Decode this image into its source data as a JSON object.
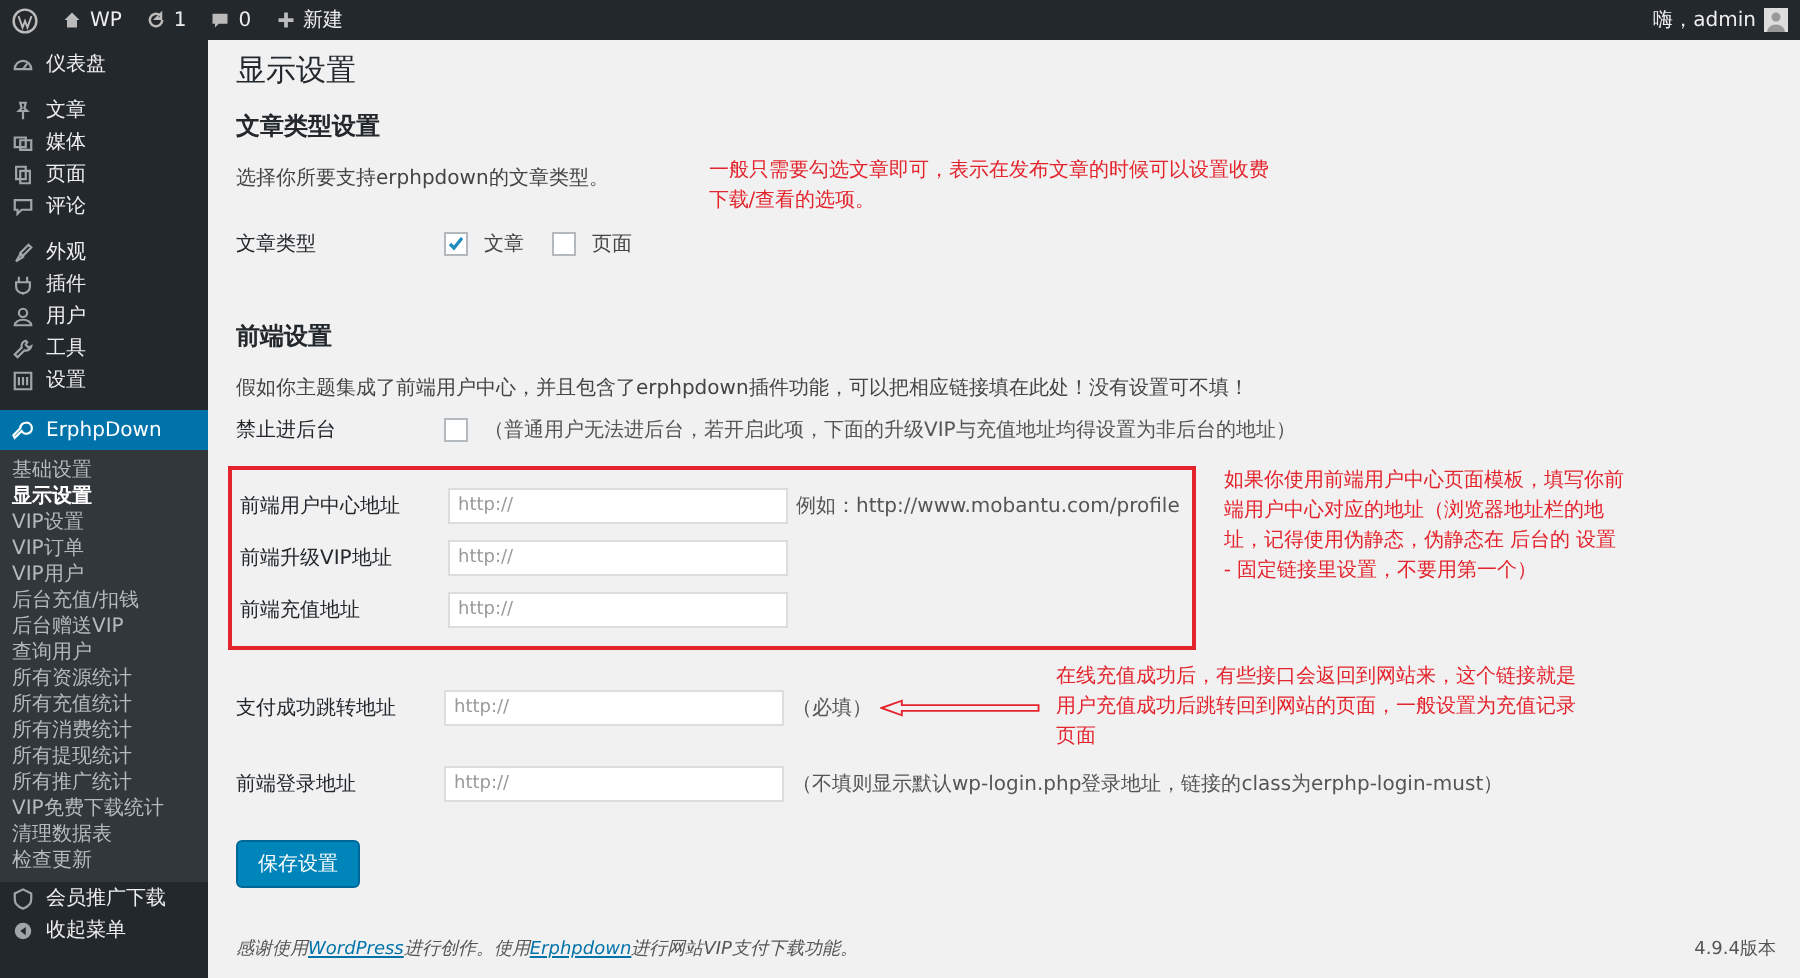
{
  "admin_bar": {
    "site": "WP",
    "updates": "1",
    "comments": "0",
    "new": "新建",
    "greeting": "嗨，admin"
  },
  "sidebar": {
    "items": [
      {
        "label": "仪表盘",
        "selected": false
      },
      {
        "label": "文章",
        "selected": false
      },
      {
        "label": "媒体",
        "selected": false
      },
      {
        "label": "页面",
        "selected": false
      },
      {
        "label": "评论",
        "selected": false
      },
      {
        "label": "外观",
        "selected": false
      },
      {
        "label": "插件",
        "selected": false
      },
      {
        "label": "用户",
        "selected": false
      },
      {
        "label": "工具",
        "selected": false
      },
      {
        "label": "设置",
        "selected": false
      },
      {
        "label": "ErphpDown",
        "selected": true,
        "children": [
          {
            "label": "基础设置",
            "selected": false
          },
          {
            "label": "显示设置",
            "selected": true
          },
          {
            "label": "VIP设置",
            "selected": false
          },
          {
            "label": "VIP订单",
            "selected": false
          },
          {
            "label": "VIP用户",
            "selected": false
          },
          {
            "label": "后台充值/扣钱",
            "selected": false
          },
          {
            "label": "后台赠送VIP",
            "selected": false
          },
          {
            "label": "查询用户",
            "selected": false
          },
          {
            "label": "所有资源统计",
            "selected": false
          },
          {
            "label": "所有充值统计",
            "selected": false
          },
          {
            "label": "所有消费统计",
            "selected": false
          },
          {
            "label": "所有提现统计",
            "selected": false
          },
          {
            "label": "所有推广统计",
            "selected": false
          },
          {
            "label": "VIP免费下载统计",
            "selected": false
          },
          {
            "label": "清理数据表",
            "selected": false
          },
          {
            "label": "检查更新",
            "selected": false
          }
        ]
      },
      {
        "label": "会员推广下载",
        "selected": false
      }
    ],
    "collapse": "收起菜单"
  },
  "page": {
    "title": "显示设置",
    "post_type_section": {
      "heading": "文章类型设置",
      "description": "选择你所要支持erphpdown的文章类型。",
      "annotation": "一般只需要勾选文章即可，表示在发布文章的时候可以设置收费下载/查看的选项。",
      "row": {
        "label": "文章类型",
        "options": [
          {
            "label": "文章",
            "checked": true
          },
          {
            "label": "页面",
            "checked": false
          }
        ]
      }
    },
    "frontend_section": {
      "heading": "前端设置",
      "description": "假如你主题集成了前端用户中心，并且包含了erphpdown插件功能，可以把相应链接填在此处！没有设置可不填！",
      "disable_admin": {
        "label": "禁止进后台",
        "checked": false,
        "note": "（普通用户无法进后台，若开启此项，下面的升级VIP与充值地址均得设置为非后台的地址）"
      },
      "highlighted_fields": [
        {
          "label": "前端用户中心地址",
          "placeholder": "http://",
          "note": "例如：http://www.mobantu.com/profile"
        },
        {
          "label": "前端升级VIP地址",
          "placeholder": "http://"
        },
        {
          "label": "前端充值地址",
          "placeholder": "http://"
        }
      ],
      "highlight_annotation": "如果你使用前端用户中心页面模板，填写你前端用户中心对应的地址（浏览器地址栏的地址，记得使用伪静态，伪静态在 后台的 设置 - 固定链接里设置，不要用第一个）",
      "fields": [
        {
          "label": "支付成功跳转地址",
          "placeholder": "http://",
          "note": "（必填）",
          "annotation": "在线充值成功后，有些接口会返回到网站来，这个链接就是用户充值成功后跳转回到网站的页面，一般设置为充值记录页面"
        },
        {
          "label": "前端登录地址",
          "placeholder": "http://",
          "note": "（不填则显示默认wp-login.php登录地址，链接的class为erphp-login-must）"
        }
      ]
    },
    "save_button": "保存设置"
  },
  "footer": {
    "before": "感谢使用",
    "link1": "WordPress",
    "middle": "进行创作。使用",
    "link2": "Erphpdown",
    "after": "进行网站VIP支付下载功能。",
    "version": "4.9.4版本"
  }
}
